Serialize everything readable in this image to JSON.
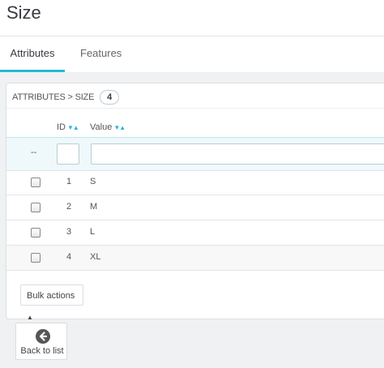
{
  "page": {
    "title": "Size"
  },
  "tabs": [
    {
      "label": "Attributes",
      "active": true
    },
    {
      "label": "Features",
      "active": false
    }
  ],
  "panel": {
    "heading": "ATTRIBUTES > SIZE",
    "count": "4",
    "columns": {
      "id": "ID",
      "value": "Value"
    },
    "filter_placeholder": "--",
    "rows": [
      {
        "id": "1",
        "value": "S"
      },
      {
        "id": "2",
        "value": "M"
      },
      {
        "id": "3",
        "value": "L"
      },
      {
        "id": "4",
        "value": "XL"
      }
    ],
    "bulk_actions_label": "Bulk actions"
  },
  "footer": {
    "back_label": "Back to list"
  },
  "colors": {
    "accent": "#25b9d7",
    "title": "#363a41",
    "background": "#eff1f2"
  },
  "icons": {
    "sort": "sort-arrows-icon",
    "back": "arrow-left-circle-icon",
    "caret": "caret-up-icon"
  }
}
